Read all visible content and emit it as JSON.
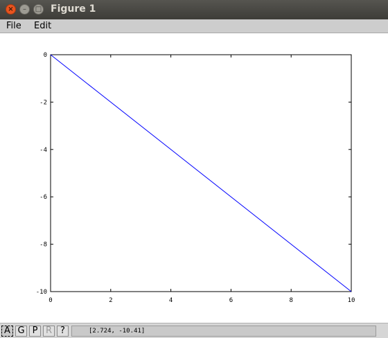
{
  "window": {
    "title": "Figure 1",
    "close_glyph": "×",
    "min_glyph": "–",
    "max_glyph": "□"
  },
  "menu": {
    "file": "File",
    "edit": "Edit"
  },
  "chart_data": {
    "type": "line",
    "x": [
      0,
      10
    ],
    "series": [
      {
        "values": [
          0,
          -10
        ],
        "color": "#0000ff"
      }
    ],
    "xlim": [
      0,
      10
    ],
    "ylim": [
      -10,
      0
    ],
    "xticks": [
      0,
      2,
      4,
      6,
      8,
      10
    ],
    "yticks": [
      0,
      -2,
      -4,
      -6,
      -8,
      -10
    ],
    "title": "",
    "xlabel": "",
    "ylabel": "",
    "grid": false
  },
  "toolbar": {
    "buttons": [
      {
        "label": "A",
        "name": "autoscale-button",
        "state": "active"
      },
      {
        "label": "G",
        "name": "grid-button",
        "state": "normal"
      },
      {
        "label": "P",
        "name": "pan-button",
        "state": "normal"
      },
      {
        "label": "R",
        "name": "rotate-button",
        "state": "disabled"
      },
      {
        "label": "?",
        "name": "help-button",
        "state": "normal"
      }
    ],
    "coordinates": "[2.724, -10.41]"
  }
}
